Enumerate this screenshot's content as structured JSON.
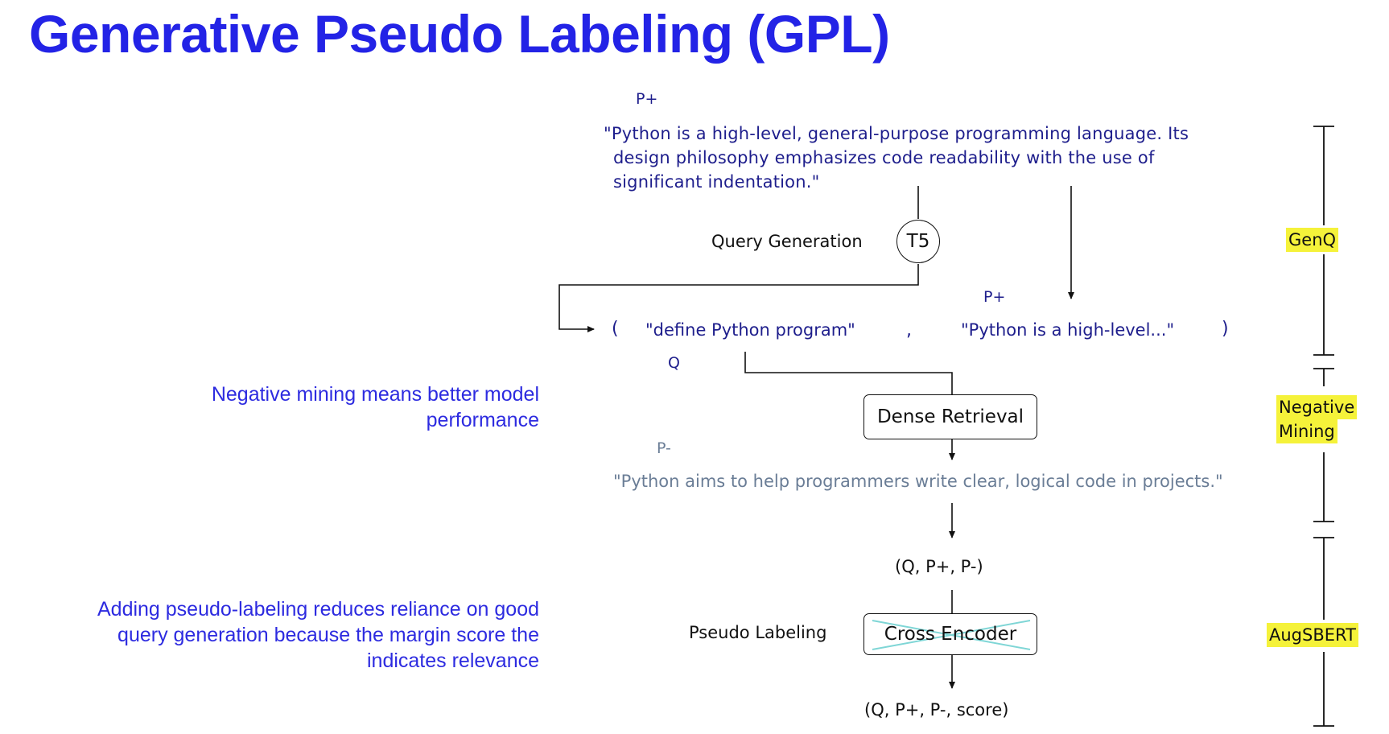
{
  "title": "Generative Pseudo Labeling (GPL)",
  "notes": {
    "negative_mining": "Negative mining means better model performance",
    "pseudo_labeling": "Adding pseudo-labeling reduces reliance on good query generation because the margin score the indicates relevance"
  },
  "diagram": {
    "p_plus_label": "P+",
    "passage_line1": "\"Python is a high-level, general-purpose programming language. Its",
    "passage_line2": "design philosophy emphasizes code readability with the use of",
    "passage_line3": "significant indentation.\"",
    "query_generation_label": "Query Generation",
    "t5_label": "T5",
    "pair_open": "(",
    "query_text": "\"define Python program\"",
    "pair_comma": ",",
    "p_plus_short_label": "P+",
    "p_plus_short_text": "\"Python is a high-level...\"",
    "pair_close": ")",
    "q_label": "Q",
    "dense_retrieval_label": "Dense Retrieval",
    "p_minus_label": "P-",
    "negative_passage": "\"Python aims to help programmers write clear, logical code in projects.\"",
    "triplet": "(Q, P+, P-)",
    "pseudo_labeling_label": "Pseudo Labeling",
    "cross_encoder_label": "Cross Encoder",
    "final_tuple": "(Q, P+, P-, score)"
  },
  "stages": {
    "genq": "GenQ",
    "negative_mining_line1": "Negative",
    "negative_mining_line2": "Mining",
    "augsbert": "AugSBERT"
  },
  "colors": {
    "title": "#2323e6",
    "notes": "#2d2be0",
    "handwriting_blue": "#1e1e8c",
    "handwriting_grey": "#6a7d96",
    "highlight": "#f5f23a",
    "cross_out": "#7fd6d6"
  }
}
